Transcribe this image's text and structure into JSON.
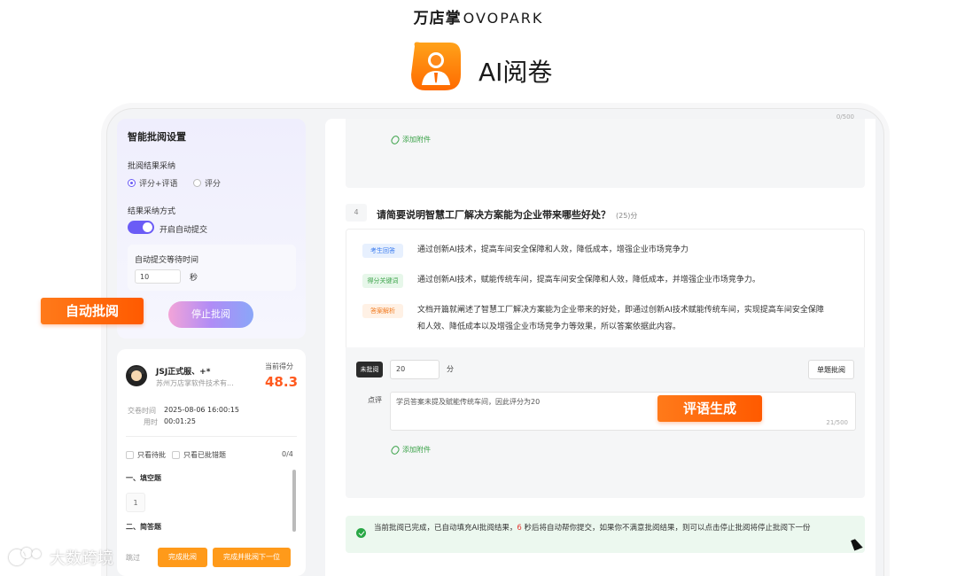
{
  "brand": {
    "cn": "万店掌",
    "latin": "OVOPARK"
  },
  "app": {
    "title": "AI阅卷",
    "accent": "#ff7a1a",
    "purple": "#6b5cf6"
  },
  "settings": {
    "title": "智能批阅设置",
    "result_label": "批阅结果采纳",
    "radio_options": [
      "评分+评语",
      "评分"
    ],
    "selected": "评分+评语",
    "adopt_label": "结果采纳方式",
    "toggle_label": "开启自动提交",
    "toggle_on": true,
    "wait_label": "自动提交等待时间",
    "wait_value": "10",
    "wait_unit": "秒",
    "stop_button": "停止批阅"
  },
  "callouts": {
    "auto_review": "自动批阅",
    "comment_gen": "评语生成"
  },
  "student": {
    "name": "JSJ正式服、+*",
    "org": "苏州万店掌软件技术有...",
    "score_label": "当前得分",
    "score": "48.3",
    "submit_label": "交卷时间",
    "submit_time": "2025-08-06 16:00:15",
    "duration_label": "用时",
    "duration": "00:01:25",
    "filter_pending": "只看待批",
    "filter_wrong": "只看已批错题",
    "progress": "0/4",
    "section1": "一、填空题",
    "q1": "1",
    "section2": "二、简答题",
    "skip": "跳过",
    "finish_button": "完成批阅",
    "finish_next_button": "完成并批阅下一位"
  },
  "top_answer": {
    "char_count": "0/500",
    "attach": "添加附件"
  },
  "question": {
    "number": "4",
    "text": "请简要说明智慧工厂解决方案能为企业带来哪些好处？",
    "points": "(25)分",
    "tag_answer": "考生回答",
    "answer": "通过创新AI技术，提高车间安全保障和人效，降低成本，增强企业市场竞争力",
    "tag_keywords": "得分关键词",
    "keywords": "通过创新AI技术，赋能传统车间，提高车间安全保障和人效，降低成本，并增强企业市场竞争力。",
    "tag_analysis": "答案解析",
    "analysis_1": "文档开篇就阐述了智慧工厂解决方案能为企业带来的好处，即通过创新AI技术赋能传统车间，实现提高车间安全保障",
    "analysis_2": "和人效、降低成本以及增强企业市场竞争力等效果，所以答案依据此内容。"
  },
  "grading": {
    "status": "未批阅",
    "score": "20",
    "unit": "分",
    "single_button": "单题批阅",
    "comment_label": "点评",
    "comment": "学员答案未提及赋能传统车间，因此评分为20",
    "char_count": "21/500",
    "attach": "添加附件"
  },
  "notice": {
    "before": "当前批阅已完成，已自动填充AI批阅结果，",
    "seconds": "6",
    "after": " 秒后将自动帮你提交，如果你不满意批阅结果，则可以点击停止批阅将停止批阅下一份"
  },
  "watermark": "大数跨境"
}
